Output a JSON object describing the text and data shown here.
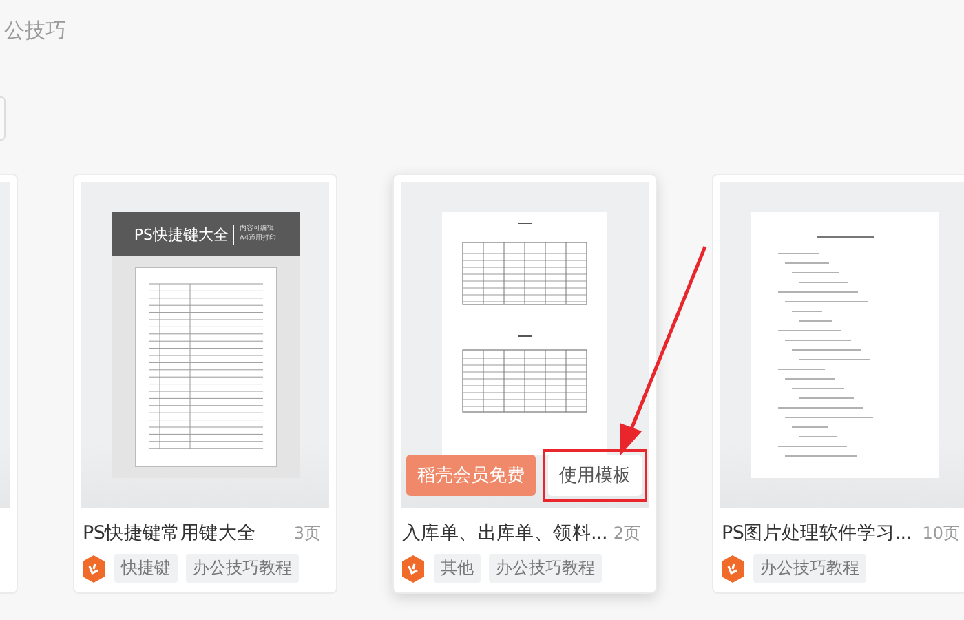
{
  "header": {
    "title": "公技巧"
  },
  "cards": [
    {
      "thumbnail": {
        "kind": "blank"
      }
    },
    {
      "title": "PS快捷键常用键大全",
      "pages": "3页",
      "thumbnail": {
        "kind": "cover",
        "heading": "PS快捷键大全",
        "notes": [
          "内容可编辑",
          "A4通用打印"
        ]
      },
      "tags": [
        "快捷键",
        "办公技巧教程"
      ]
    },
    {
      "title": "入库单、出库单、领料...",
      "pages": "2页",
      "thumbnail": {
        "kind": "forms"
      },
      "tags": [
        "其他",
        "办公技巧教程"
      ],
      "actions": [
        {
          "label": "稻壳会员免费",
          "kind": "primary",
          "highlighted": false
        },
        {
          "label": "使用模板",
          "kind": "secondary",
          "highlighted": true
        }
      ]
    },
    {
      "title": "PS图片处理软件学习...",
      "pages": "10页",
      "thumbnail": {
        "kind": "outline"
      },
      "tags": [
        "办公技巧教程"
      ]
    }
  ],
  "annotations": [
    {
      "kind": "arrow"
    }
  ]
}
